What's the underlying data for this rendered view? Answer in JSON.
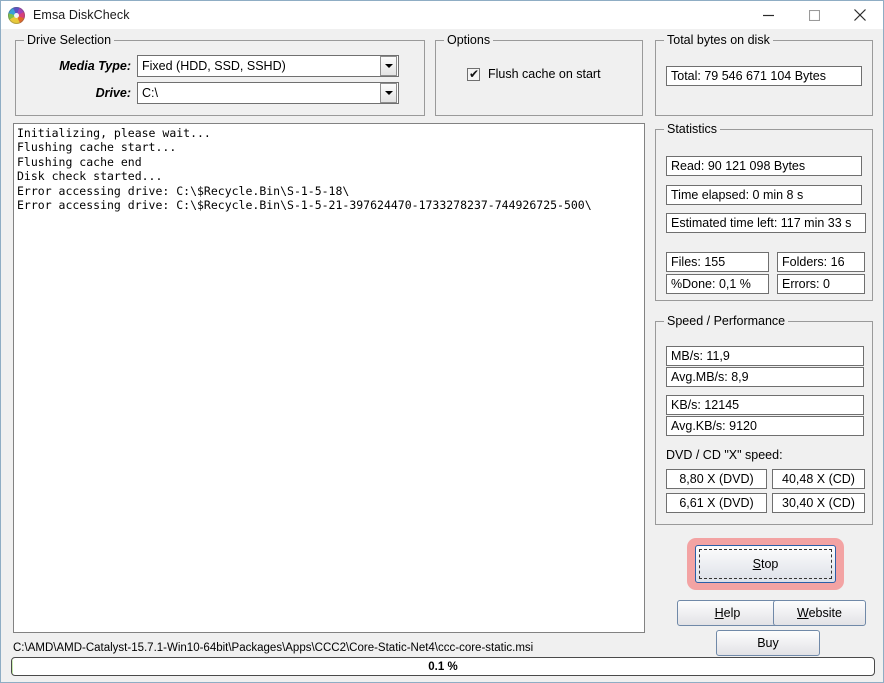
{
  "window": {
    "title": "Emsa DiskCheck",
    "icon": "disc-icon",
    "controls": {
      "minimize": "—",
      "maximize": "☐",
      "close": "✕"
    },
    "border_color": "#8fadc4",
    "background_color": "#f0f0f0"
  },
  "drive_selection": {
    "group_title": "Drive Selection",
    "media_type_label": "Media Type:",
    "media_type_value": "Fixed (HDD, SSD, SSHD)",
    "drive_label": "Drive:",
    "drive_value": "C:\\"
  },
  "options": {
    "group_title": "Options",
    "flush_cache_label": "Flush cache on start",
    "flush_cache_checked": true,
    "check_glyph": "✔"
  },
  "log": {
    "lines": "Initializing, please wait...\nFlushing cache start...\nFlushing cache end\nDisk check started...\nError accessing drive: C:\\$Recycle.Bin\\S-1-5-18\\\nError accessing drive: C:\\$Recycle.Bin\\S-1-5-21-397624470-1733278237-744926725-500\\"
  },
  "total_bytes": {
    "group_title": "Total bytes on disk",
    "total_value": "Total: 79 546 671 104 Bytes"
  },
  "statistics": {
    "group_title": "Statistics",
    "read": "Read: 90 121 098 Bytes",
    "time_elapsed": "Time elapsed: 0 min 8 s",
    "estimated_time_left": "Estimated time left: 117 min 33 s",
    "files": "Files:  155",
    "folders": "Folders:  16",
    "done": "%Done:  0,1 %",
    "errors": "Errors:  0"
  },
  "speed": {
    "group_title": "Speed / Performance",
    "mbs": "MB/s: 11,9",
    "avg_mbs": "Avg.MB/s: 8,9",
    "kbs": "KB/s: 12145",
    "avg_kbs": "Avg.KB/s: 9120",
    "dvd_cd_label": "DVD / CD \"X\" speed:",
    "dvd_current": "8,80 X (DVD)",
    "cd_current": "40,48 X (CD)",
    "dvd_avg": "6,61 X (DVD)",
    "cd_avg": "30,40 X (CD)"
  },
  "buttons": {
    "stop": "Stop",
    "stop_accesskey": "S",
    "stop_rest": "top",
    "stop_focus_color": "#f3a3a3",
    "help_accesskey": "H",
    "help_rest": "elp",
    "website_accesskey": "W",
    "website_rest": "ebsite",
    "buy": "Buy"
  },
  "status": {
    "current_path": "C:\\AMD\\AMD-Catalyst-15.7.1-Win10-64bit\\Packages\\Apps\\CCC2\\Core-Static-Net4\\ccc-core-static.msi",
    "progress_text": "0.1 %",
    "progress_percent": 0.1
  }
}
